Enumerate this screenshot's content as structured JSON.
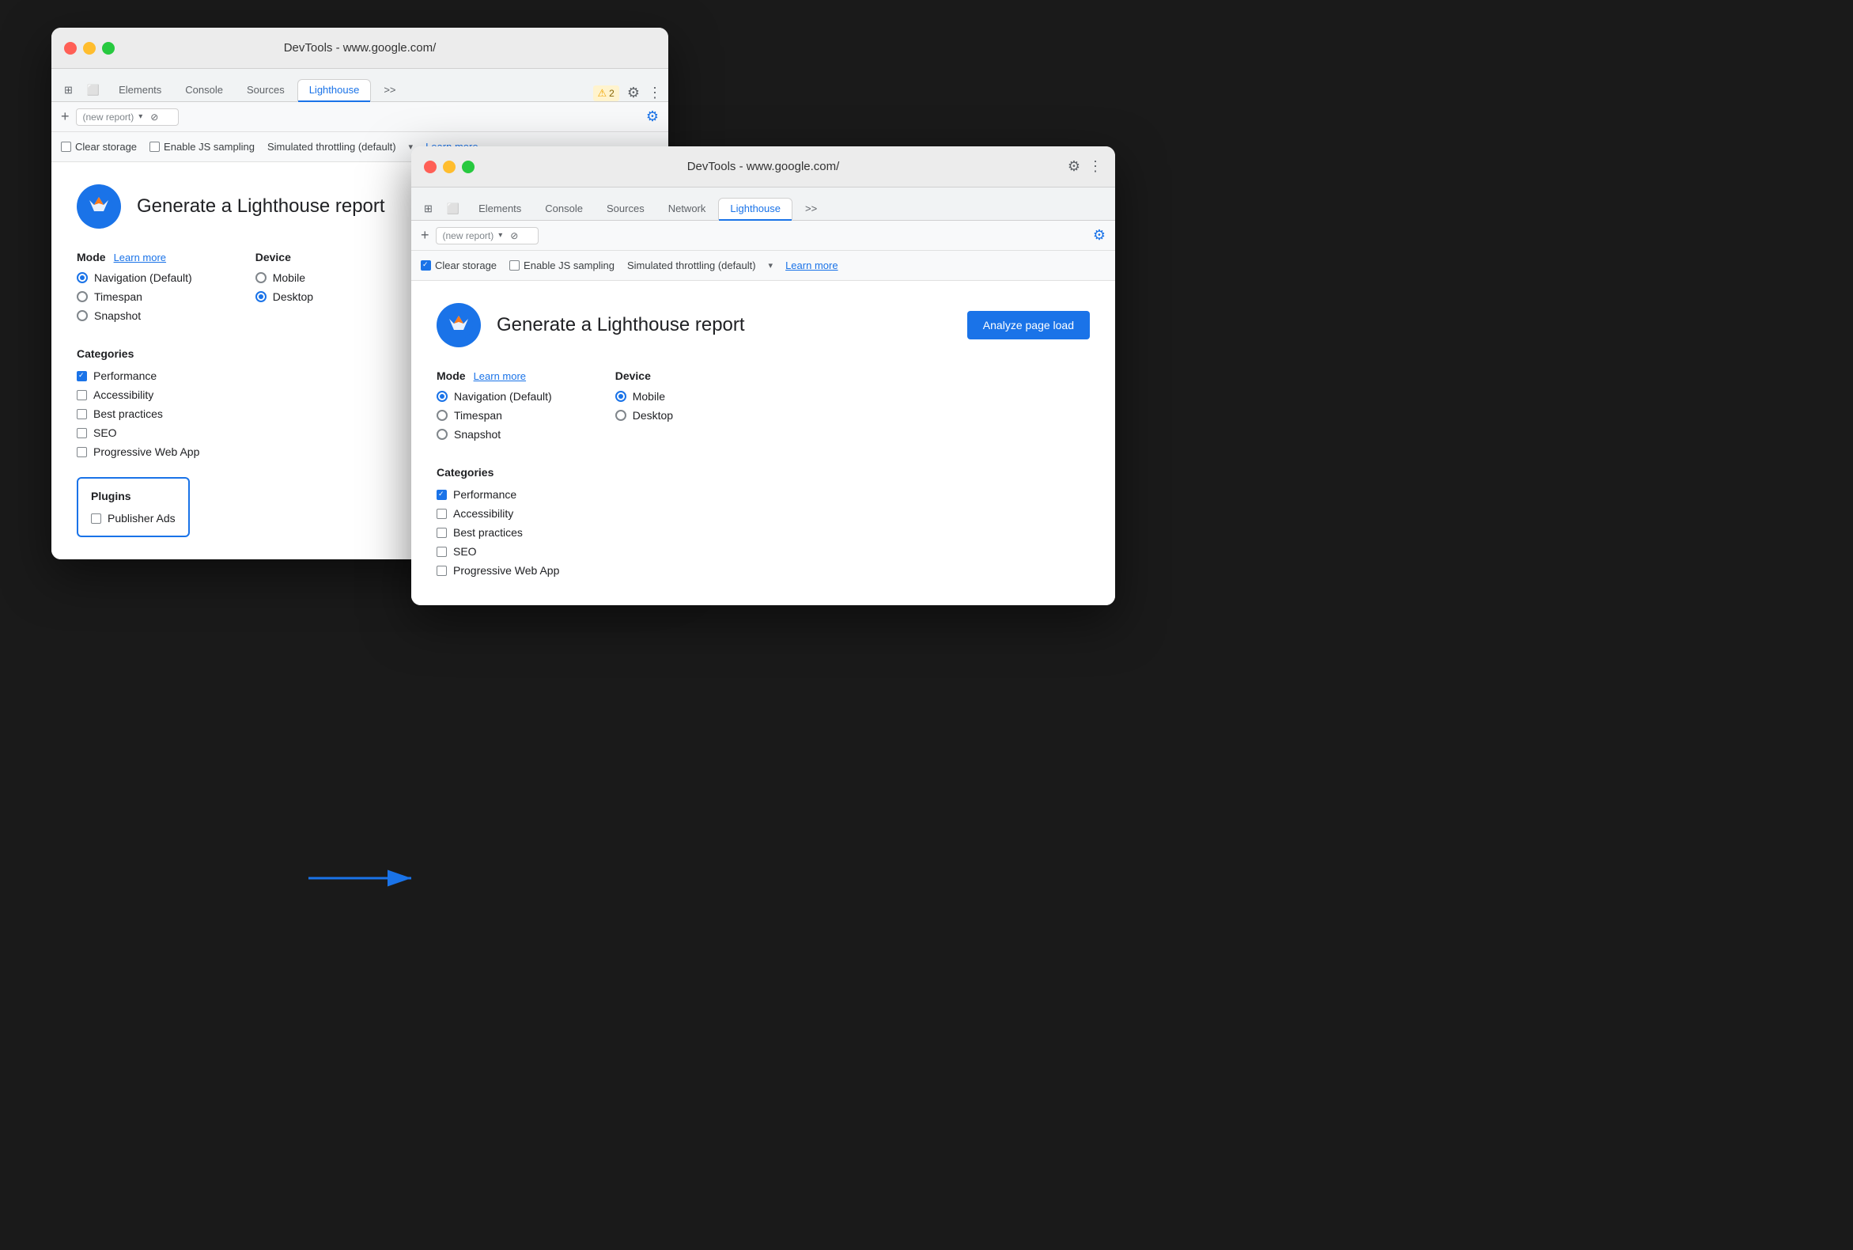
{
  "window1": {
    "title": "DevTools - www.google.com/",
    "tabs": [
      "Elements",
      "Console",
      "Sources",
      "Lighthouse",
      ">>"
    ],
    "active_tab": "Lighthouse",
    "toolbar": {
      "plus": "+",
      "report_placeholder": "(new report)",
      "cancel_icon": "⊘"
    },
    "options": {
      "clear_storage": "Clear storage",
      "clear_storage_checked": false,
      "enable_js": "Enable JS sampling",
      "enable_js_checked": false,
      "throttling": "Simulated throttling (default)",
      "learn_more": "Learn more"
    },
    "report": {
      "title": "Generate a Lighthouse report",
      "mode_label": "Mode",
      "learn_more": "Learn more",
      "device_label": "Device",
      "modes": [
        "Navigation (Default)",
        "Timespan",
        "Snapshot"
      ],
      "mode_selected": 0,
      "devices": [
        "Mobile",
        "Desktop"
      ],
      "device_selected": 1,
      "categories_label": "Categories",
      "categories": [
        "Performance",
        "Accessibility",
        "Best practices",
        "SEO",
        "Progressive Web App"
      ],
      "categories_checked": [
        true,
        false,
        false,
        false,
        false
      ],
      "plugins_label": "Plugins",
      "plugins": [
        "Publisher Ads"
      ],
      "plugins_checked": [
        false
      ]
    }
  },
  "window2": {
    "title": "DevTools - www.google.com/",
    "tabs": [
      "Elements",
      "Console",
      "Sources",
      "Network",
      "Lighthouse",
      ">>"
    ],
    "active_tab": "Lighthouse",
    "toolbar": {
      "plus": "+",
      "report_placeholder": "(new report)",
      "cancel_icon": "⊘"
    },
    "options": {
      "clear_storage": "Clear storage",
      "clear_storage_checked": true,
      "enable_js": "Enable JS sampling",
      "enable_js_checked": false,
      "throttling": "Simulated throttling (default)",
      "learn_more": "Learn more"
    },
    "report": {
      "title": "Generate a Lighthouse report",
      "analyze_btn": "Analyze page load",
      "mode_label": "Mode",
      "learn_more": "Learn more",
      "device_label": "Device",
      "modes": [
        "Navigation (Default)",
        "Timespan",
        "Snapshot"
      ],
      "mode_selected": 0,
      "devices": [
        "Mobile",
        "Desktop"
      ],
      "device_selected": 0,
      "categories_label": "Categories",
      "categories": [
        "Performance",
        "Accessibility",
        "Best practices",
        "SEO",
        "Progressive Web App"
      ],
      "categories_checked": [
        true,
        false,
        false,
        false,
        false
      ]
    },
    "warning": {
      "icon": "⚠",
      "count": "2"
    }
  }
}
